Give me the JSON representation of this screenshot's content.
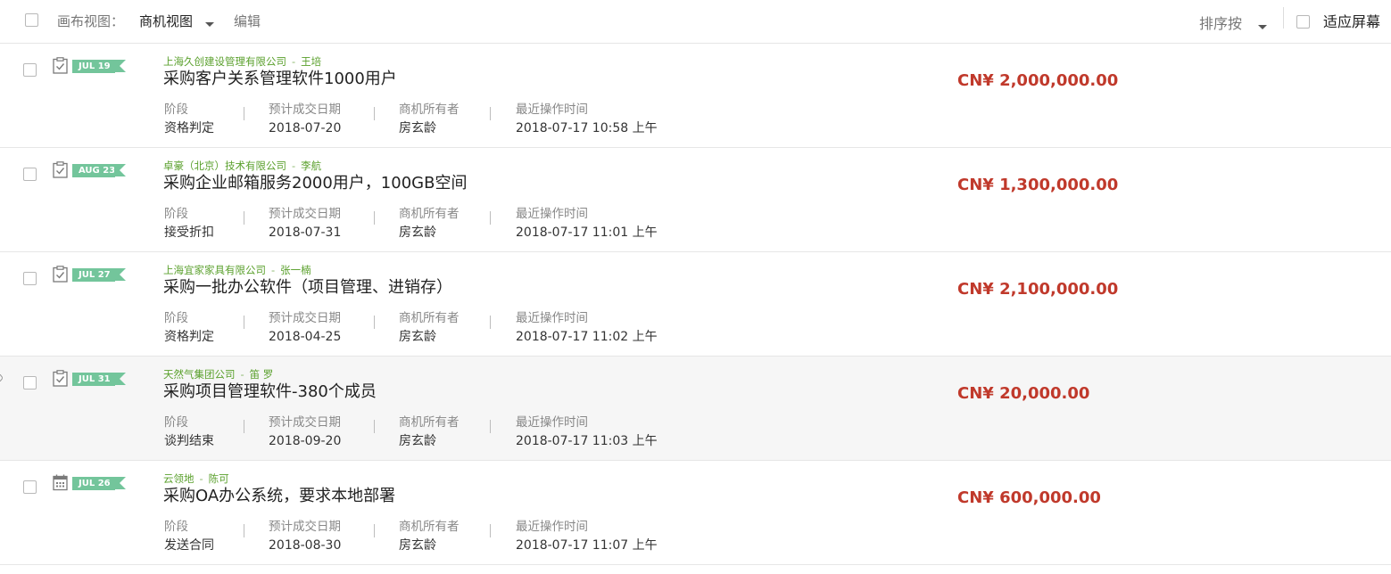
{
  "toolbar": {
    "canvas_view_label": "画布视图：",
    "deal_view_label": "商机视图",
    "edit_label": "编辑",
    "sort_label": "排序按",
    "fit_screen_label": "适应屏幕"
  },
  "field_labels": {
    "stage": "阶段",
    "close_date": "预计成交日期",
    "owner": "商机所有者",
    "last_activity": "最近操作时间"
  },
  "colors": {
    "accent_green": "#73c59b",
    "account_green": "#5aa02c",
    "amount_red": "#c0392b"
  },
  "deals": [
    {
      "tag": "JUL 19",
      "icon": "clipboard-check-icon",
      "account": "上海久创建设管理有限公司",
      "contact": "王培",
      "title": "采购客户关系管理软件1000用户",
      "stage": "资格判定",
      "close_date": "2018-07-20",
      "owner": "房玄龄",
      "last_activity": "2018-07-17 10:58 上午",
      "amount": "CN¥ 2,000,000.00"
    },
    {
      "tag": "AUG 23",
      "icon": "clipboard-check-icon",
      "account": "卓豪（北京）技术有限公司",
      "contact": "李航",
      "title": "采购企业邮箱服务2000用户，100GB空间",
      "stage": "接受折扣",
      "close_date": "2018-07-31",
      "owner": "房玄龄",
      "last_activity": "2018-07-17 11:01 上午",
      "amount": "CN¥ 1,300,000.00"
    },
    {
      "tag": "JUL 27",
      "icon": "clipboard-check-icon",
      "account": "上海宜家家具有限公司",
      "contact": "张一楠",
      "title": "采购一批办公软件（项目管理、进销存）",
      "stage": "资格判定",
      "close_date": "2018-04-25",
      "owner": "房玄龄",
      "last_activity": "2018-07-17 11:02 上午",
      "amount": "CN¥ 2,100,000.00"
    },
    {
      "tag": "JUL 31",
      "icon": "clipboard-check-icon",
      "account": "天然气集团公司",
      "contact": "笛 罗",
      "title": "采购项目管理软件-380个成员",
      "stage": "谈判结束",
      "close_date": "2018-09-20",
      "owner": "房玄龄",
      "last_activity": "2018-07-17 11:03 上午",
      "amount": "CN¥ 20,000.00"
    },
    {
      "tag": "JUL 26",
      "icon": "calendar-icon",
      "account": "云领地",
      "contact": "陈可",
      "title": "采购OA办公系统，要求本地部署",
      "stage": "发送合同",
      "close_date": "2018-08-30",
      "owner": "房玄龄",
      "last_activity": "2018-07-17 11:07 上午",
      "amount": "CN¥ 600,000.00"
    }
  ]
}
